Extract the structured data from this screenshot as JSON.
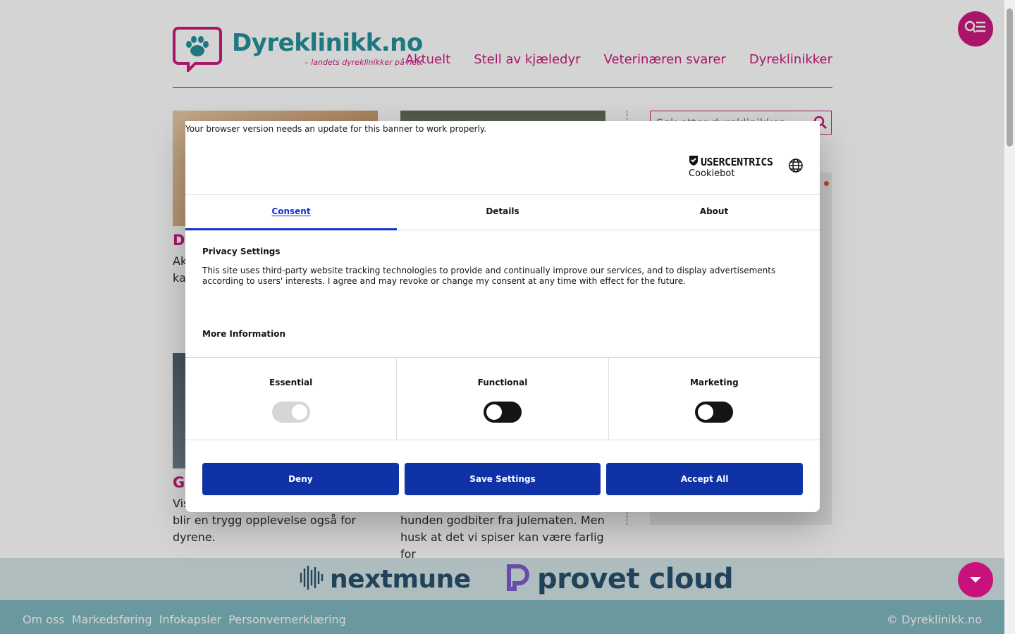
{
  "header": {
    "logo_name": "Dyreklinikk.no",
    "logo_tagline": "– landets dyreklinikker på nett",
    "nav": [
      "Aktuelt",
      "Stell av kjæledyr",
      "Veterinæren svarer",
      "Dyreklinikker"
    ]
  },
  "search": {
    "placeholder": "Søk etter dyreklinikker"
  },
  "articles": [
    {
      "title": "Dy",
      "text": "Ak\nkat"
    },
    {
      "title": "",
      "text": ""
    },
    {
      "title": "Go",
      "text": "Vis\nblir en trygg opplevelse også for dyrene."
    },
    {
      "title": "",
      "text": "Det kan være fristende å tilby hunden godbiter fra julematen. Men husk at det vi spiser kan være farlig for"
    }
  ],
  "sponsors": [
    "nextmune",
    "provet cloud"
  ],
  "footer": {
    "links": [
      "Om oss",
      "Markedsføring",
      "Infokapsler",
      "Personvernerklæring"
    ],
    "copyright": "© Dyreklinikk.no"
  },
  "consent": {
    "browser_warning": "Your browser version needs an update for this banner to work properly.",
    "brand_name": "USERCENTRICS",
    "brand_sub": "Cookiebot",
    "tabs": [
      "Consent",
      "Details",
      "About"
    ],
    "active_tab": "Consent",
    "privacy_title": "Privacy Settings",
    "privacy_text": "This site uses third-party website tracking technologies to provide and continually improve our services, and to display advertisements according to users' interests. I agree and may revoke or change my consent at any time with effect for the future.",
    "more_info": "More Information",
    "categories": [
      {
        "label": "Essential",
        "enabled": true,
        "locked": true
      },
      {
        "label": "Functional",
        "enabled": false,
        "locked": false
      },
      {
        "label": "Marketing",
        "enabled": false,
        "locked": false
      }
    ],
    "buttons": {
      "deny": "Deny",
      "save": "Save Settings",
      "accept": "Accept All"
    }
  },
  "colors": {
    "brand": "#c8117a",
    "teal": "#1c8c95",
    "consent_blue": "#1032a7",
    "footer": "#7bb4bd"
  },
  "icons": [
    "paw-icon",
    "search-icon",
    "menu-search-icon",
    "chevron-down-icon",
    "globe-icon",
    "shield-icon"
  ]
}
